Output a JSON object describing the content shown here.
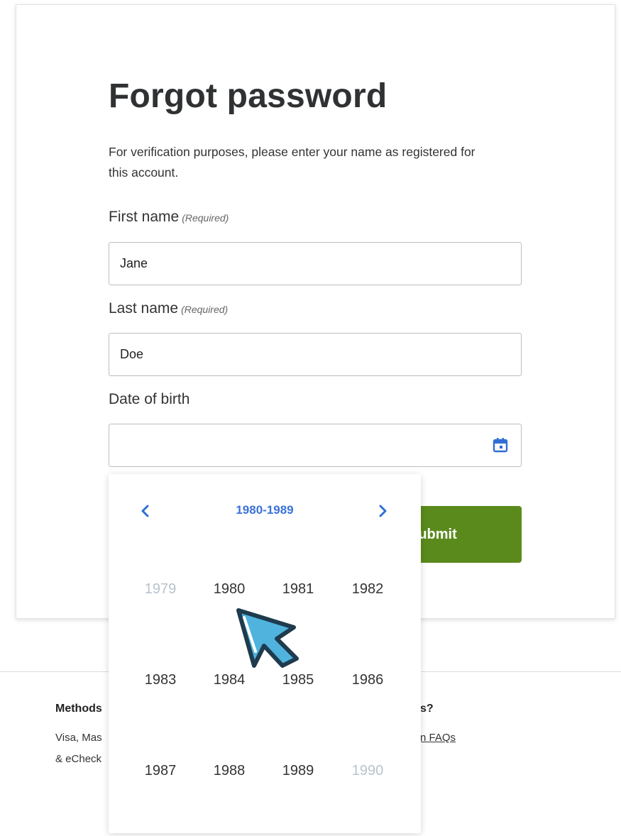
{
  "form": {
    "title": "Forgot password",
    "intro": "For verification purposes, please enter your name as registered for this account.",
    "first_name_label": "First name",
    "first_name_required": "(Required)",
    "first_name_value": "Jane",
    "last_name_label": "Last name",
    "last_name_required": "(Required)",
    "last_name_value": "Doe",
    "dob_label": "Date of birth",
    "dob_value": "",
    "submit_label": "Submit"
  },
  "datepicker": {
    "decade_label": "1980-1989",
    "prev_icon": "chevron-left-icon",
    "next_icon": "chevron-right-icon",
    "years": [
      "1979",
      "1980",
      "1981",
      "1982",
      "1983",
      "1984",
      "1985",
      "1986",
      "1987",
      "1988",
      "1989",
      "1990"
    ],
    "accent_color": "#3b72d9"
  },
  "footer": {
    "methods_heading": "Methods",
    "methods_line1": "Visa, Mas",
    "methods_line2": "& eCheck",
    "questions_heading": "s?",
    "faq_link": "n FAQs"
  },
  "colors": {
    "submit_bg": "#5a8a1c",
    "cursor_fill": "#4fb3de"
  }
}
